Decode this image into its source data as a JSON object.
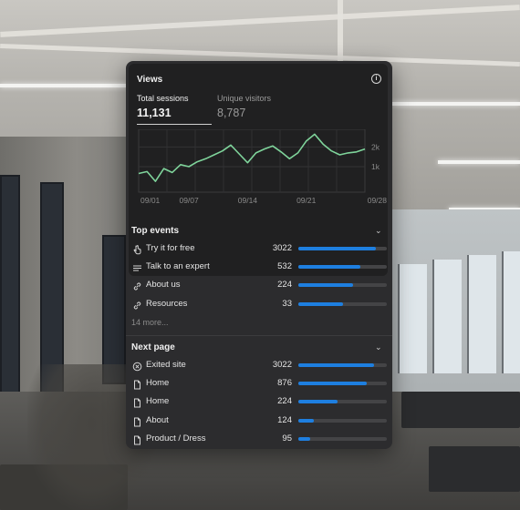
{
  "views": {
    "title": "Views",
    "info_icon": "info-icon",
    "metrics": [
      {
        "label": "Total sessions",
        "value": "11,131"
      },
      {
        "label": "Unique visitors",
        "value": "8,787"
      }
    ]
  },
  "chart_data": {
    "type": "line",
    "x": [
      "09/01",
      "09/02",
      "09/03",
      "09/04",
      "09/05",
      "09/06",
      "09/07",
      "09/08",
      "09/09",
      "09/10",
      "09/11",
      "09/12",
      "09/13",
      "09/14",
      "09/15",
      "09/16",
      "09/17",
      "09/18",
      "09/19",
      "09/20",
      "09/21",
      "09/22",
      "09/23",
      "09/24",
      "09/25",
      "09/26",
      "09/27",
      "09/28"
    ],
    "values": [
      0.95,
      1.05,
      0.55,
      1.2,
      1.0,
      1.4,
      1.3,
      1.55,
      1.7,
      1.9,
      2.1,
      2.4,
      1.95,
      1.5,
      2.0,
      2.2,
      2.35,
      2.05,
      1.7,
      2.0,
      2.6,
      2.95,
      2.45,
      2.1,
      1.9,
      2.0,
      2.05,
      2.2
    ],
    "xticks": [
      "09/01",
      "09/07",
      "09/14",
      "09/21",
      "09/28"
    ],
    "yticks": [
      "2k",
      "1k"
    ],
    "ytick_values": [
      2.3,
      1.3
    ],
    "ylim": [
      0,
      3.2
    ],
    "color": "#7fd49b",
    "grid": true
  },
  "top_events": {
    "title": "Top events",
    "items": [
      {
        "icon": "pointer-hand-icon",
        "label": "Try it for free",
        "count": "3022",
        "fraction": 0.88
      },
      {
        "icon": "lines-icon",
        "label": "Talk to an expert",
        "count": "532",
        "fraction": 0.7
      },
      {
        "icon": "link-icon",
        "label": "About us",
        "count": "224",
        "fraction": 0.62
      },
      {
        "icon": "link-icon",
        "label": "Resources",
        "count": "33",
        "fraction": 0.5
      }
    ],
    "more": "14 more..."
  },
  "next_page": {
    "title": "Next page",
    "items": [
      {
        "icon": "exit-circle-icon",
        "label": "Exited site",
        "count": "3022",
        "fraction": 0.86
      },
      {
        "icon": "page-icon",
        "label": "Home",
        "count": "876",
        "fraction": 0.77
      },
      {
        "icon": "page-icon",
        "label": "Home",
        "count": "224",
        "fraction": 0.44
      },
      {
        "icon": "page-icon",
        "label": "About",
        "count": "124",
        "fraction": 0.18
      },
      {
        "icon": "page-icon",
        "label": "Product / Dress",
        "count": "95",
        "fraction": 0.13
      }
    ]
  },
  "colors": {
    "accent": "#1e7fe0",
    "panel": "#2c2c2e",
    "chart_line": "#7fd49b"
  }
}
